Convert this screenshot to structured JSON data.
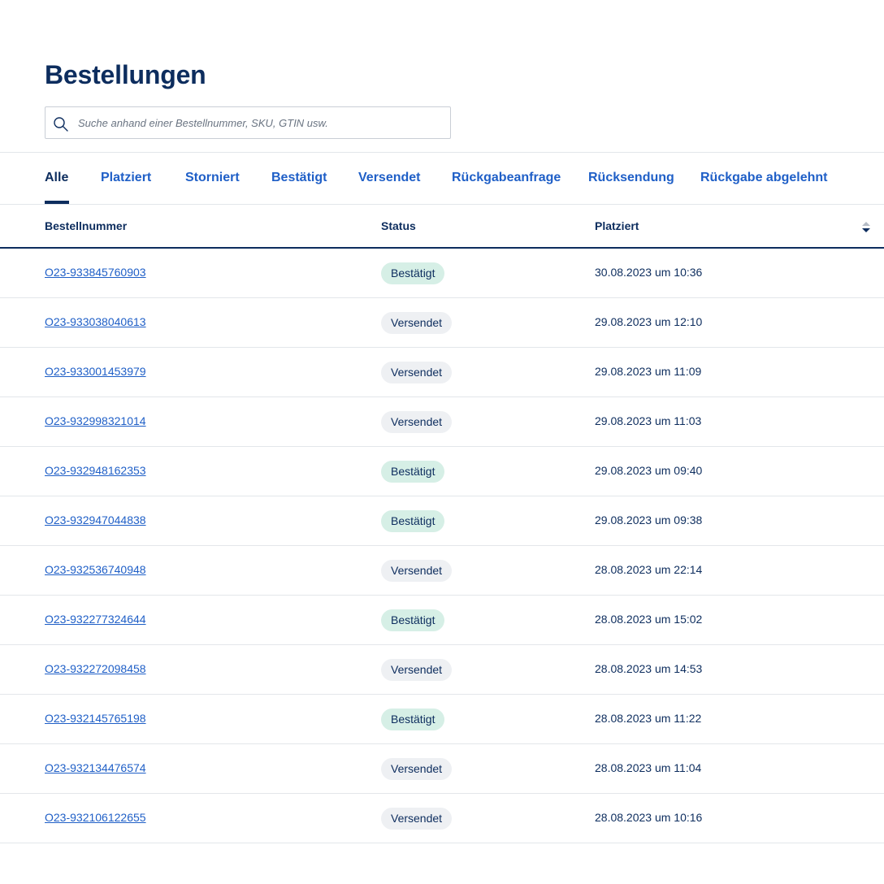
{
  "page": {
    "title": "Bestellungen"
  },
  "search": {
    "placeholder": "Suche anhand einer Bestellnummer, SKU, GTIN usw.",
    "value": ""
  },
  "tabs": [
    {
      "label": "Alle",
      "active": true
    },
    {
      "label": "Platziert",
      "active": false
    },
    {
      "label": "Storniert",
      "active": false
    },
    {
      "label": "Bestätigt",
      "active": false
    },
    {
      "label": "Versendet",
      "active": false
    },
    {
      "label": "Rückgabeanfrage",
      "active": false
    },
    {
      "label": "Rücksendung",
      "active": false
    },
    {
      "label": "Rückgabe abgelehnt",
      "active": false
    }
  ],
  "table": {
    "columns": {
      "order_number": "Bestellnummer",
      "status": "Status",
      "placed": "Platziert"
    },
    "sort": {
      "column": "placed",
      "icon": "sort-icon"
    },
    "rows": [
      {
        "order": "O23-933845760903",
        "status": "Bestätigt",
        "status_type": "confirmed",
        "date": "30.08.2023 um 10:36"
      },
      {
        "order": "O23-933038040613",
        "status": "Versendet",
        "status_type": "shipped",
        "date": "29.08.2023 um 12:10"
      },
      {
        "order": "O23-933001453979",
        "status": "Versendet",
        "status_type": "shipped",
        "date": "29.08.2023 um 11:09"
      },
      {
        "order": "O23-932998321014",
        "status": "Versendet",
        "status_type": "shipped",
        "date": "29.08.2023 um 11:03"
      },
      {
        "order": "O23-932948162353",
        "status": "Bestätigt",
        "status_type": "confirmed",
        "date": "29.08.2023 um 09:40"
      },
      {
        "order": "O23-932947044838",
        "status": "Bestätigt",
        "status_type": "confirmed",
        "date": "29.08.2023 um 09:38"
      },
      {
        "order": "O23-932536740948",
        "status": "Versendet",
        "status_type": "shipped",
        "date": "28.08.2023 um 22:14"
      },
      {
        "order": "O23-932277324644",
        "status": "Bestätigt",
        "status_type": "confirmed",
        "date": "28.08.2023 um 15:02"
      },
      {
        "order": "O23-932272098458",
        "status": "Versendet",
        "status_type": "shipped",
        "date": "28.08.2023 um 14:53"
      },
      {
        "order": "O23-932145765198",
        "status": "Bestätigt",
        "status_type": "confirmed",
        "date": "28.08.2023 um 11:22"
      },
      {
        "order": "O23-932134476574",
        "status": "Versendet",
        "status_type": "shipped",
        "date": "28.08.2023 um 11:04"
      },
      {
        "order": "O23-932106122655",
        "status": "Versendet",
        "status_type": "shipped",
        "date": "28.08.2023 um 10:16"
      }
    ]
  },
  "colors": {
    "primary_dark": "#0d2d5e",
    "link_blue": "#1f5fc7",
    "badge_confirmed_bg": "#d6efe6",
    "badge_shipped_bg": "#eef0f3",
    "divider": "#e3e6ea"
  },
  "icons": {
    "search": "search-icon",
    "sort": "sort-icon"
  }
}
